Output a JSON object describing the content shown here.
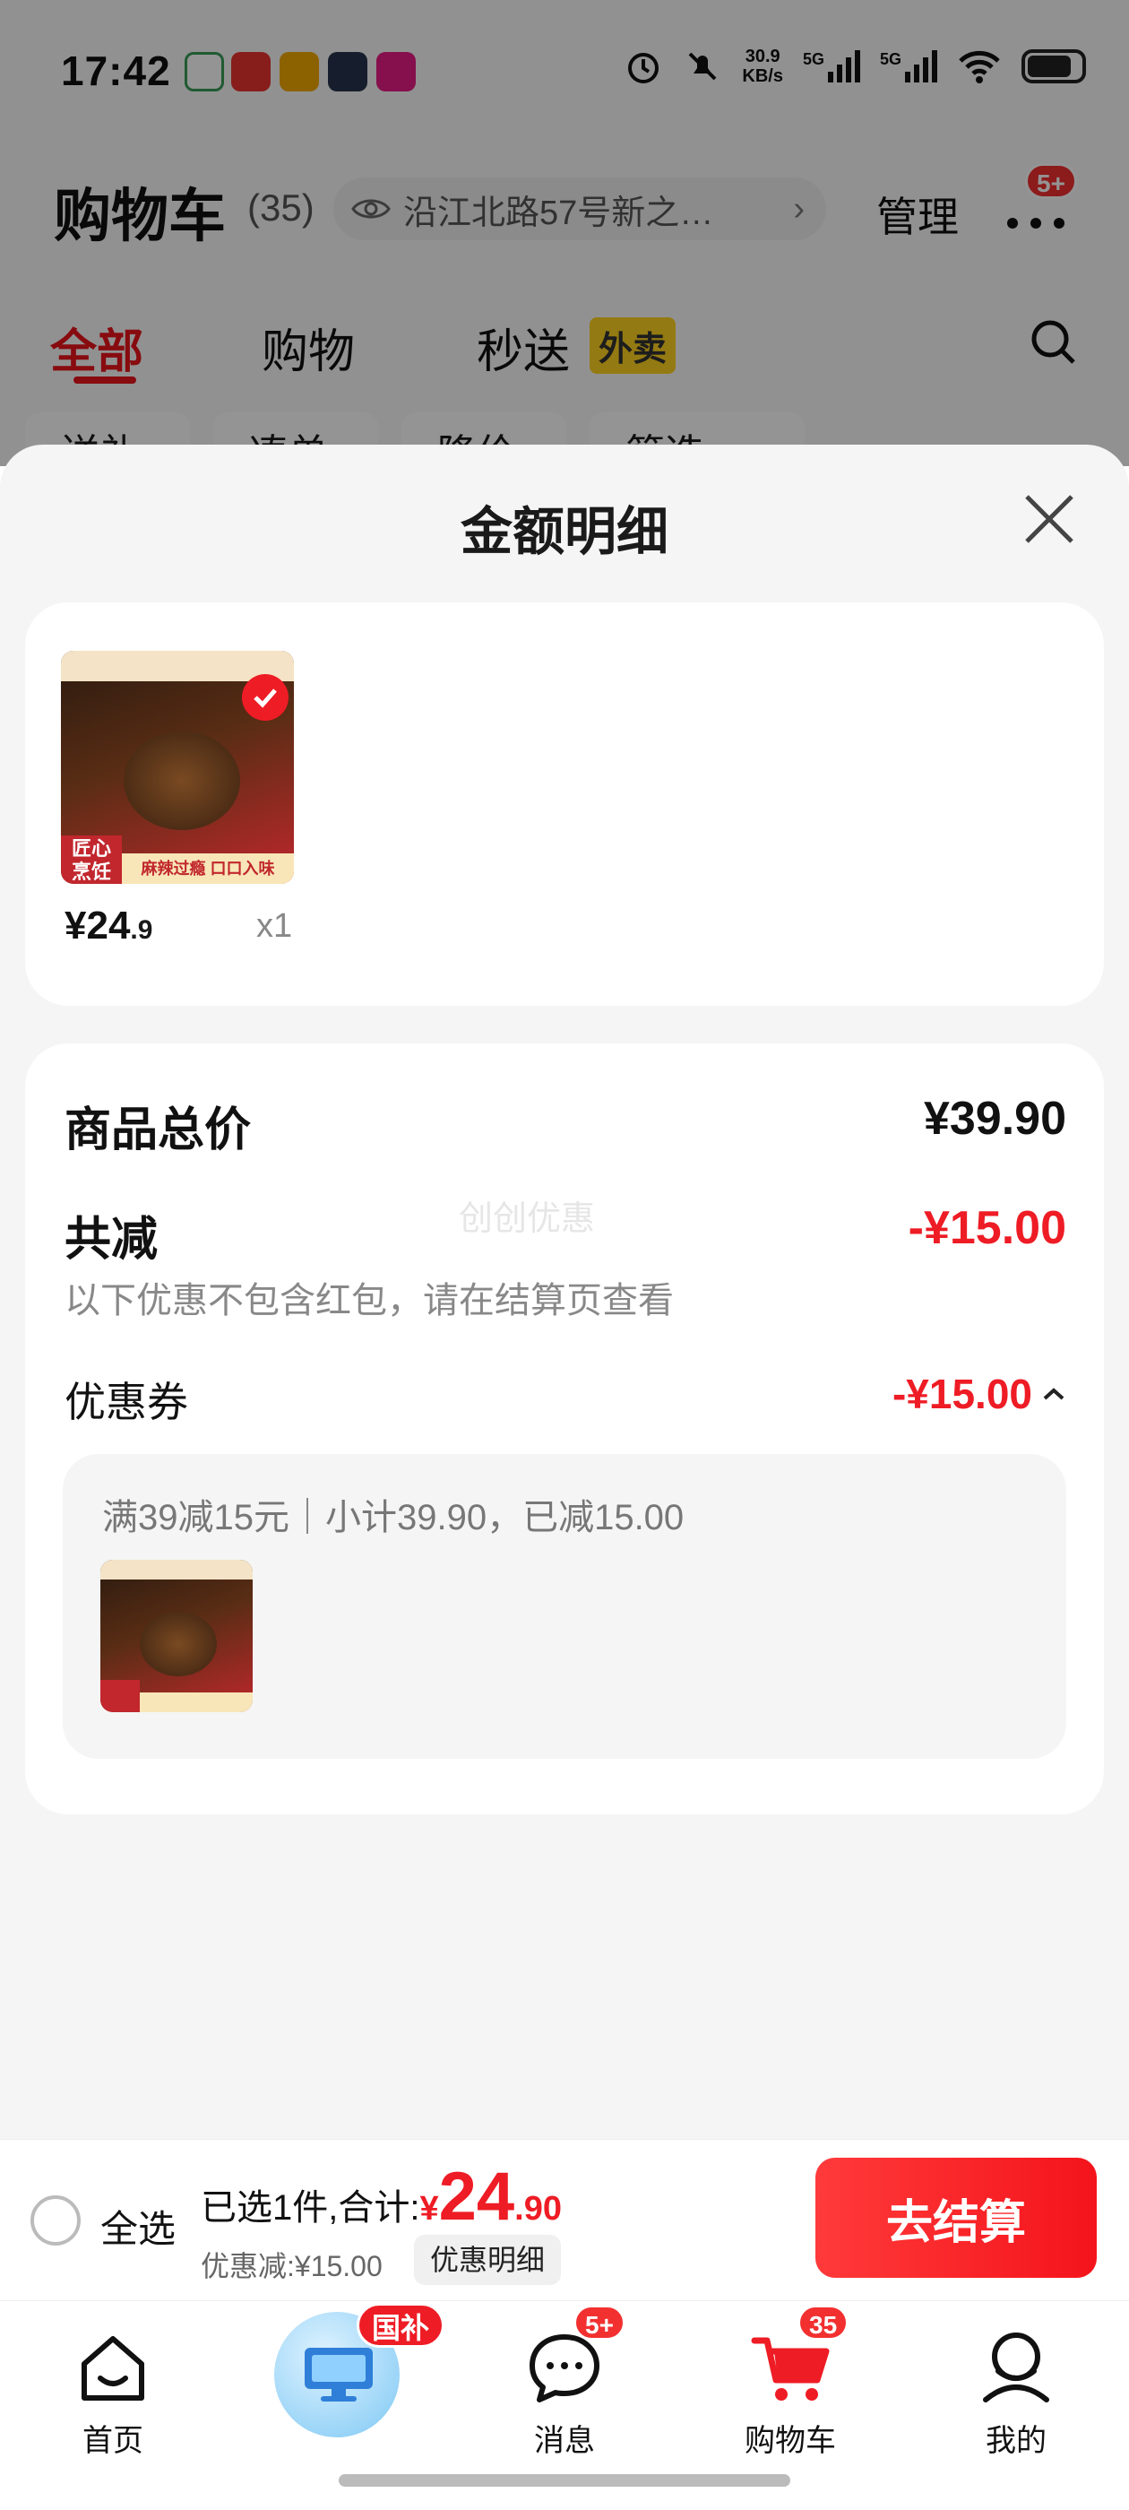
{
  "status_bar": {
    "time": "17:42",
    "net_speed": "30.9",
    "net_unit": "KB/s",
    "sig1": "5G",
    "sig2": "5G"
  },
  "header": {
    "title": "购物车",
    "count": "(35)",
    "address": "沿江北路57号新之…",
    "manage": "管理",
    "more_badge": "5+"
  },
  "tabs": [
    {
      "label": "全部"
    },
    {
      "label": "购物"
    },
    {
      "label": "秒送"
    }
  ],
  "tabs_badge": "外卖",
  "filters": [
    "送礼",
    "凑单",
    "降价",
    "筛选"
  ],
  "sheet": {
    "title": "金额明细",
    "item": {
      "price_main": "¥24",
      "price_dec": ".9",
      "qty": "x1",
      "overlay_corner": "匠心\n烹饪",
      "overlay_banner": "麻辣过瘾 口口入味"
    },
    "total_label": "商品总价",
    "total_value": "¥39.90",
    "reduce_label": "共减",
    "reduce_value": "-¥15.00",
    "reduce_note": "以下优惠不包含红包，请在结算页查看",
    "watermark": "创创优惠",
    "coupon_label": "优惠券",
    "coupon_value": "-¥15.00",
    "coupon_detail": "满39减15元｜小计39.90，已减15.00"
  },
  "bottom_bar": {
    "select_all": "全选",
    "selected_text": "已选1件,合计:",
    "currency": "¥",
    "total_main": "24",
    "total_dec": ".90",
    "discount_text": "优惠减:¥15.00",
    "discount_detail_btn": "优惠明细",
    "checkout": "去结算"
  },
  "nav": {
    "items": [
      {
        "label": "首页"
      },
      {
        "label": ""
      },
      {
        "label": "消息"
      },
      {
        "label": "购物车"
      },
      {
        "label": "我的"
      }
    ],
    "guobu_badge": "国补",
    "msg_badge": "5+",
    "cart_badge": "35"
  },
  "colors": {
    "accent": "#ee1c25",
    "active_tab": "#e8141b",
    "waimai_bg": "#ffd21f"
  }
}
